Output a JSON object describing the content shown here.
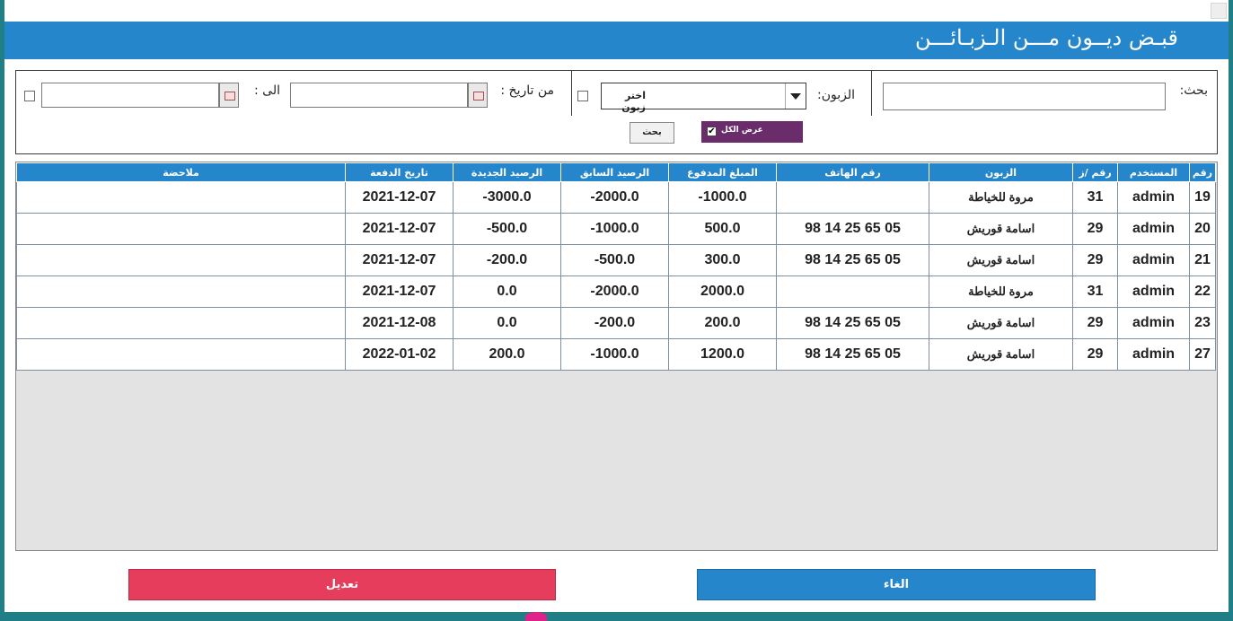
{
  "window": {
    "title": "قبـض ديــون مـــن الـزبـائـــن"
  },
  "filters": {
    "search_label": "بحث:",
    "customer_label": "الزبون:",
    "customer_combo_value": "اختر زبون",
    "from_date_label": "من تاريخ :",
    "to_date_label": "الى :",
    "search_button": "بحث",
    "show_all_label": "عرض الكل",
    "show_all_checked": true
  },
  "table": {
    "headers": [
      "رقم",
      "المستخدم",
      "رقم /ز",
      "الزبون",
      "رقم الهاتف",
      "المبلغ المدفوع",
      "الرصيد السابق",
      "الرصيد الجديدة",
      "تاريخ الدفعة",
      "ملاحضة"
    ],
    "rows": [
      [
        "19",
        "admin",
        "31",
        "مروة للخياطة",
        "",
        "1000.0-",
        "2000.0-",
        "3000.0-",
        "2021-12-07",
        ""
      ],
      [
        "20",
        "admin",
        "29",
        "اسامة قوريش",
        "05 65 25 14 98",
        "500.0",
        "1000.0-",
        "500.0-",
        "2021-12-07",
        ""
      ],
      [
        "21",
        "admin",
        "29",
        "اسامة قوريش",
        "05 65 25 14 98",
        "300.0",
        "500.0-",
        "200.0-",
        "2021-12-07",
        ""
      ],
      [
        "22",
        "admin",
        "31",
        "مروة للخياطة",
        "",
        "2000.0",
        "2000.0-",
        "0.0",
        "2021-12-07",
        ""
      ],
      [
        "23",
        "admin",
        "29",
        "اسامة قوريش",
        "05 65 25 14 98",
        "200.0",
        "200.0-",
        "0.0",
        "2021-12-08",
        ""
      ],
      [
        "27",
        "admin",
        "29",
        "اسامة قوريش",
        "05 65 25 14 98",
        "1200.0",
        "1000.0-",
        "200.0",
        "2022-01-02",
        ""
      ]
    ]
  },
  "actions": {
    "edit": "تعديل",
    "cancel": "الغاء"
  },
  "colors": {
    "accent": "#2586cc",
    "danger": "#e63d5c",
    "purple": "#6b2c6c"
  }
}
